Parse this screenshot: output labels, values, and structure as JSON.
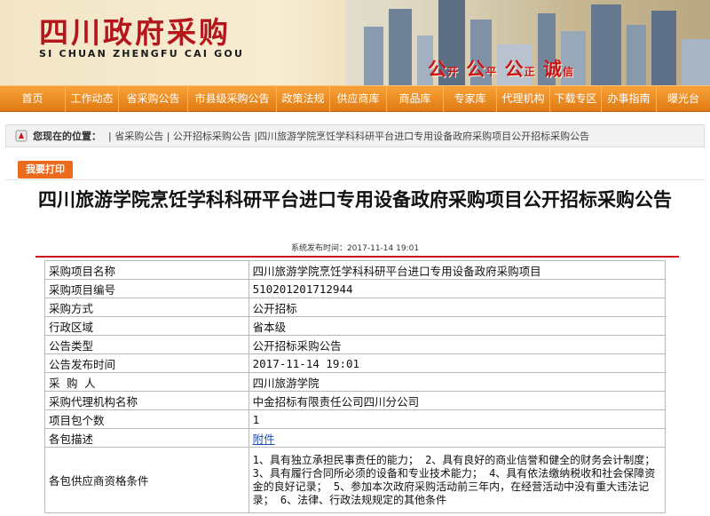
{
  "header": {
    "logo_cn": "四川政府采购",
    "logo_en": "SI CHUAN ZHENGFU CAI GOU",
    "slogan": [
      "公",
      "开",
      "公",
      "平",
      "公",
      "正",
      "诚",
      "信"
    ]
  },
  "nav": [
    "首页",
    "工作动态",
    "省采购公告",
    "市县级采购公告",
    "政策法规",
    "供应商库",
    "商品库",
    "专家库",
    "代理机构",
    "下载专区",
    "办事指南",
    "曝光台"
  ],
  "breadcrumb": {
    "label": "您现在的位置：",
    "path": "| 省采购公告 | 公开招标采购公告 |四川旅游学院烹饪学科科研平台进口专用设备政府采购项目公开招标采购公告"
  },
  "print_button": "我要打印",
  "title": "四川旅游学院烹饪学科科研平台进口专用设备政府采购项目公开招标采购公告",
  "publish_time": "系统发布时间：2017-11-14 19:01",
  "table": [
    {
      "key": "采购项目名称",
      "value": "四川旅游学院烹饪学科科研平台进口专用设备政府采购项目"
    },
    {
      "key": "采购项目编号",
      "value": "510201201712944"
    },
    {
      "key": "采购方式",
      "value": "公开招标"
    },
    {
      "key": "行政区域",
      "value": "省本级"
    },
    {
      "key": "公告类型",
      "value": "公开招标采购公告"
    },
    {
      "key": "公告发布时间",
      "value": "2017-11-14 19:01"
    },
    {
      "key": "采 购 人",
      "value": "四川旅游学院"
    },
    {
      "key": "采购代理机构名称",
      "value": "中金招标有限责任公司四川分公司"
    },
    {
      "key": "项目包个数",
      "value": "1"
    },
    {
      "key": "各包描述",
      "value": "附件"
    },
    {
      "key": "各包供应商资格条件",
      "value": "1、具有独立承担民事责任的能力； 2、具有良好的商业信誉和健全的财务会计制度； 3、具有履行合同所必须的设备和专业技术能力； 4、具有依法缴纳税收和社会保障资金的良好记录； 5、参加本次政府采购活动前三年内，在经营活动中没有重大违法记录； 6、法律、行政法规规定的其他条件"
    }
  ]
}
